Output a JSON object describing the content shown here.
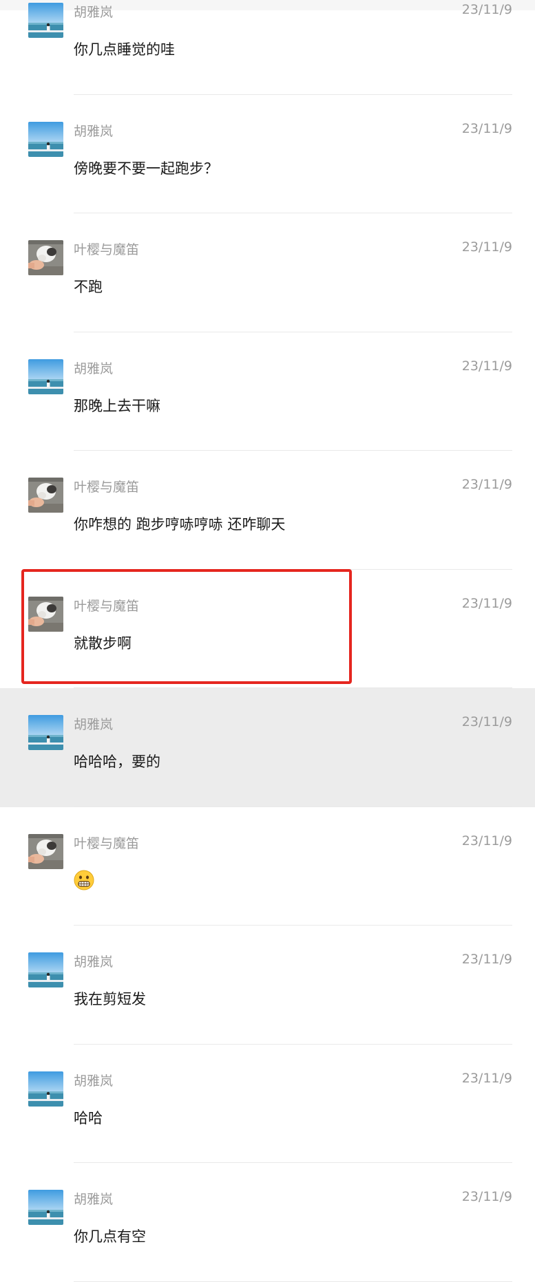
{
  "messages": [
    {
      "name": "胡雅岚",
      "time": "23/11/9",
      "text": "你几点睡觉的哇",
      "avatar": "sea-avatar"
    },
    {
      "name": "胡雅岚",
      "time": "23/11/9",
      "text": "傍晚要不要一起跑步？",
      "avatar": "sea-avatar"
    },
    {
      "name": "叶樱与魔笛",
      "time": "23/11/9",
      "text": "不跑",
      "avatar": "cat-avatar"
    },
    {
      "name": "胡雅岚",
      "time": "23/11/9",
      "text": "那晚上去干嘛",
      "avatar": "sea-avatar"
    },
    {
      "name": "叶樱与魔笛",
      "time": "23/11/9",
      "text": "你咋想的 跑步哼哧哼哧 还咋聊天",
      "avatar": "cat-avatar"
    },
    {
      "name": "叶樱与魔笛",
      "time": "23/11/9",
      "text": "就散步啊",
      "avatar": "cat-avatar"
    },
    {
      "name": "胡雅岚",
      "time": "23/11/9",
      "text": "哈哈哈，要的",
      "avatar": "sea-avatar"
    },
    {
      "name": "叶樱与魔笛",
      "time": "23/11/9",
      "text": "",
      "emoji": "grinning-face-emoji",
      "avatar": "cat-avatar"
    },
    {
      "name": "胡雅岚",
      "time": "23/11/9",
      "text": "我在剪短发",
      "avatar": "sea-avatar"
    },
    {
      "name": "胡雅岚",
      "time": "23/11/9",
      "text": "哈哈",
      "avatar": "sea-avatar"
    },
    {
      "name": "胡雅岚",
      "time": "23/11/9",
      "text": "你几点有空",
      "avatar": "sea-avatar"
    }
  ],
  "selected_index": 5,
  "highlighted_index": 6,
  "colors": {
    "name_gray": "#9b9b9b",
    "text": "#1a1a1a",
    "highlight_bg": "#ececec",
    "selection_border": "#e5261f"
  }
}
